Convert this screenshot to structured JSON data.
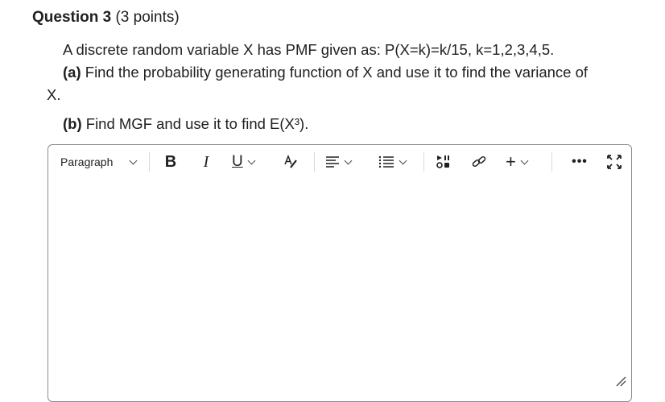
{
  "question": {
    "title": "Question 3",
    "points": "(3 points)",
    "intro": "A discrete random variable X has PMF given as: P(X=k)=k/15, k=1,2,3,4,5.",
    "part_a_label": "(a)",
    "part_a_text": "Find the probability generating function of X and use it to find the variance of",
    "part_a_tail": "X.",
    "part_b_label": "(b)",
    "part_b_text": "Find MGF and use it to find E(X³)."
  },
  "editor": {
    "toolbar": {
      "format_label": "Paragraph",
      "bold": "B",
      "italic": "I",
      "underline": "U",
      "insert": "+",
      "more": "•••"
    },
    "icons": [
      "chevron-down-icon",
      "bold-icon",
      "italic-icon",
      "underline-icon",
      "text-color-icon",
      "align-icon",
      "list-icon",
      "media-icon",
      "link-icon",
      "insert-icon",
      "more-icon",
      "fullscreen-icon",
      "resize-handle-icon"
    ],
    "content": ""
  }
}
